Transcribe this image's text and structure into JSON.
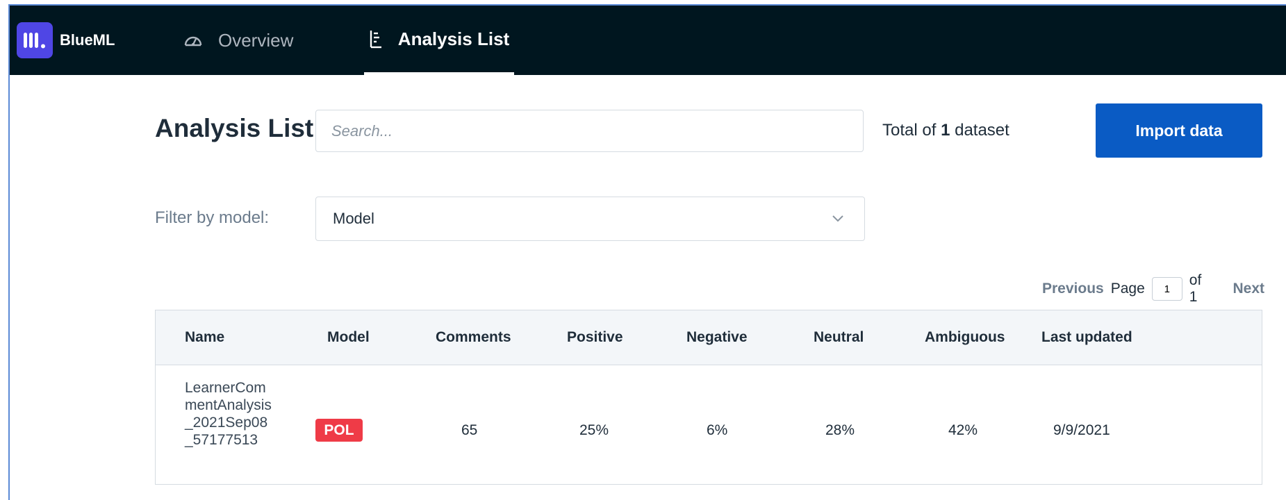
{
  "app": {
    "name": "BlueML"
  },
  "nav": {
    "items": [
      {
        "label": "Overview",
        "icon": "gauge-icon",
        "active": false
      },
      {
        "label": "Analysis List",
        "icon": "list-icon",
        "active": true
      }
    ]
  },
  "header": {
    "title": "Analysis List",
    "search_placeholder": "Search...",
    "total_prefix": "Total of",
    "total_count": "1",
    "total_suffix": "dataset",
    "import_label": "Import data"
  },
  "filter": {
    "label": "Filter by model:",
    "selected": "Model"
  },
  "pagination": {
    "previous_label": "Previous",
    "page_label": "Page",
    "current_page": "1",
    "of_label": "of 1",
    "next_label": "Next"
  },
  "table": {
    "columns": [
      "Name",
      "Model",
      "Comments",
      "Positive",
      "Negative",
      "Neutral",
      "Ambiguous",
      "Last updated"
    ],
    "rows": [
      {
        "name": "LearnerCommentAnalysis_2021Sep08_57177513",
        "model": "POL",
        "comments": "65",
        "positive": "25%",
        "negative": "6%",
        "neutral": "28%",
        "ambiguous": "42%",
        "last_updated": "9/9/2021"
      }
    ]
  },
  "colors": {
    "nav_bg": "#00161f",
    "logo_bg": "#4f46e5",
    "primary_button": "#0a5bc4",
    "badge_red": "#ef3b47"
  }
}
